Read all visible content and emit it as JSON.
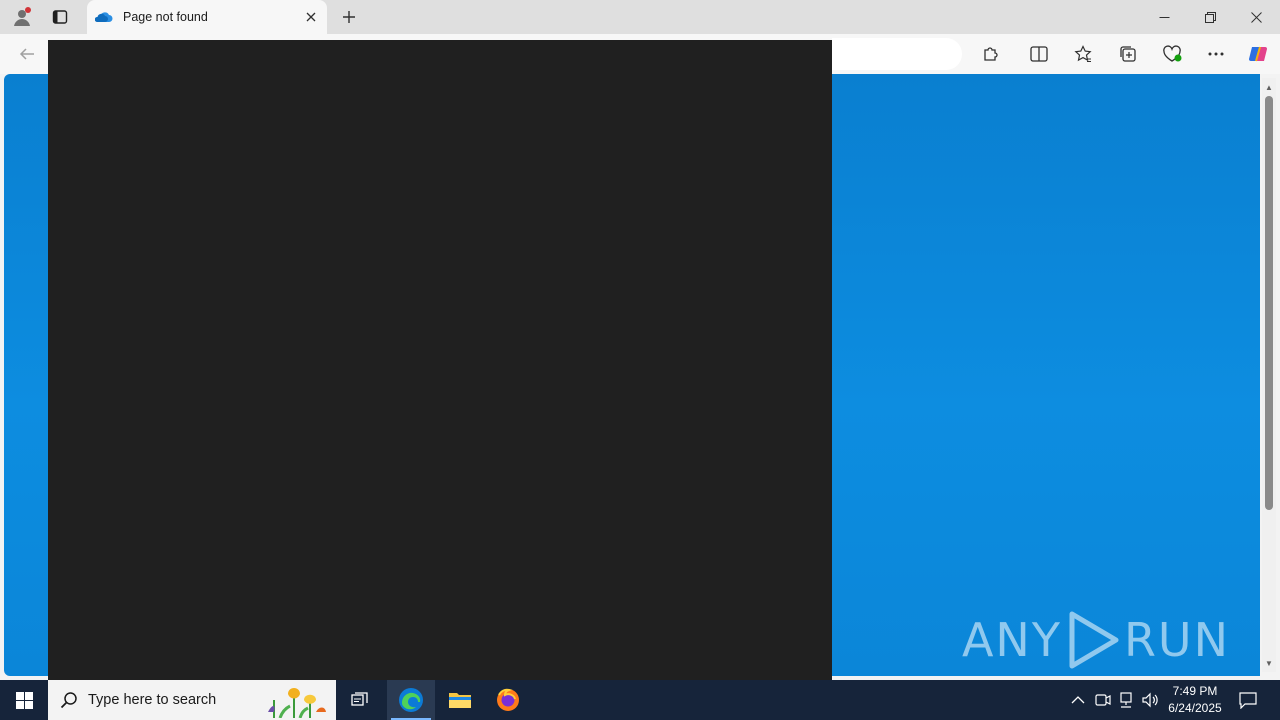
{
  "browser": {
    "tab": {
      "title": "Page not found"
    }
  },
  "watermark": {
    "left": "ANY",
    "right": "RUN"
  },
  "taskbar": {
    "search_placeholder": "Type here to search",
    "clock": {
      "time": "7:49 PM",
      "date": "6/24/2025"
    }
  },
  "colors": {
    "page_background": "#0a7fd0",
    "overlay": "#202020",
    "taskbar": "#16243a"
  },
  "icons": {
    "tab_favicon": "cloud-icon",
    "start": "windows-logo-icon",
    "task_view": "task-view-icon",
    "edge": "edge-icon",
    "explorer": "folder-icon",
    "firefox": "firefox-icon"
  }
}
